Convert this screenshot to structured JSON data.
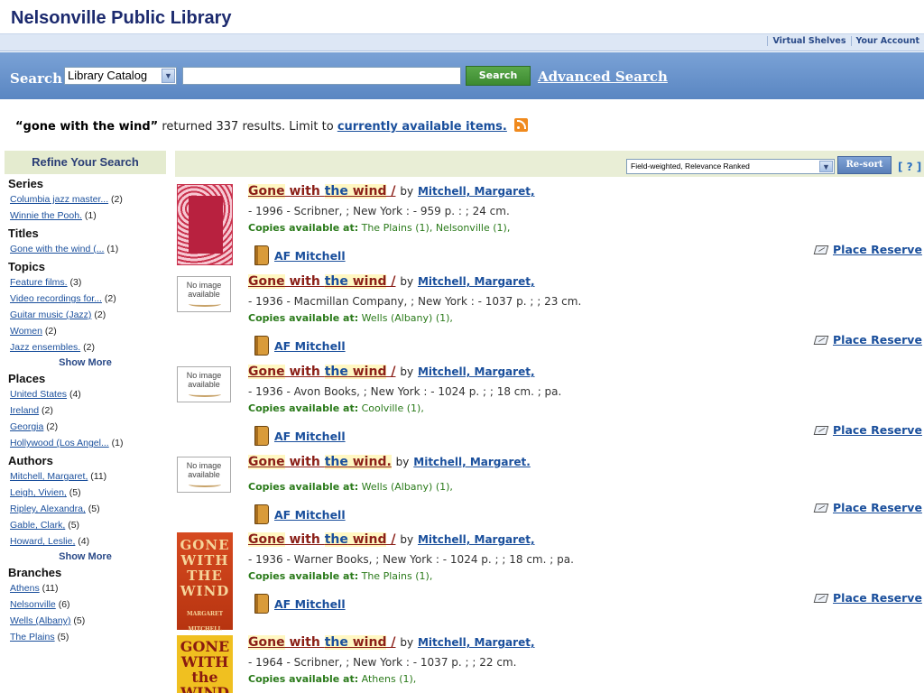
{
  "header": {
    "title": "Nelsonville Public Library"
  },
  "topnav": {
    "links": [
      "Virtual Shelves",
      "Your Account"
    ]
  },
  "search": {
    "label": "Search",
    "scope": "Library Catalog",
    "query_value": "",
    "button": "Search",
    "advanced": "Advanced Search"
  },
  "summary": {
    "query": "“gone with the wind”",
    "text": " returned 337 results. Limit to ",
    "limit_link": "currently available items."
  },
  "sort": {
    "selected": "Field-weighted, Relevance Ranked",
    "button": "Re-sort",
    "help": "[ ? ]"
  },
  "sidebar": {
    "title": "Refine Your Search",
    "facets": [
      {
        "title": "Series",
        "items": [
          {
            "label": "Columbia jazz master...",
            "count": "(2)"
          },
          {
            "label": "Winnie the Pooh.",
            "count": "(1)"
          }
        ]
      },
      {
        "title": "Titles",
        "items": [
          {
            "label": "Gone with the wind (...",
            "count": "(1)"
          }
        ]
      },
      {
        "title": "Topics",
        "items": [
          {
            "label": "Feature films.",
            "count": "(3)"
          },
          {
            "label": "Video recordings for...",
            "count": "(2)"
          },
          {
            "label": "Guitar music (Jazz)",
            "count": "(2)"
          },
          {
            "label": "Women",
            "count": "(2)"
          },
          {
            "label": "Jazz ensembles.",
            "count": "(2)"
          }
        ],
        "more": "Show More"
      },
      {
        "title": "Places",
        "items": [
          {
            "label": "United States",
            "count": "(4)"
          },
          {
            "label": "Ireland",
            "count": "(2)"
          },
          {
            "label": "Georgia",
            "count": "(2)"
          },
          {
            "label": "Hollywood (Los Angel...",
            "count": "(1)"
          }
        ]
      },
      {
        "title": "Authors",
        "items": [
          {
            "label": "Mitchell, Margaret,",
            "count": "(11)"
          },
          {
            "label": "Leigh, Vivien,",
            "count": "(5)"
          },
          {
            "label": "Ripley, Alexandra,",
            "count": "(5)"
          },
          {
            "label": "Gable, Clark,",
            "count": "(5)"
          },
          {
            "label": "Howard, Leslie,",
            "count": "(4)"
          }
        ],
        "more": "Show More"
      },
      {
        "title": "Branches",
        "items": [
          {
            "label": "Athens",
            "count": "(11)"
          },
          {
            "label": "Nelsonville",
            "count": "(6)"
          },
          {
            "label": "Wells (Albany)",
            "count": "(5)"
          },
          {
            "label": "The Plains",
            "count": "(5)"
          }
        ]
      }
    ]
  },
  "results": [
    {
      "cover": "red",
      "t1": "Gone",
      "t2": " with ",
      "t3": "the",
      "t4": " wind",
      "t5": " /",
      "by": "by",
      "author": "Mitchell, Margaret,",
      "pub": "- 1996 - Scribner, ; New York : - 959 p. : ; 24 cm.",
      "copies_label": "Copies available at:",
      "copies": "The Plains (1), Nelsonville (1),",
      "call": "AF Mitchell",
      "reserve": "Place Reserve"
    },
    {
      "cover": "none",
      "noimage": "No image available",
      "t1": "Gone",
      "t2": " with ",
      "t3": "the",
      "t4": " wind",
      "t5": " /",
      "by": "by",
      "author": "Mitchell, Margaret,",
      "pub": "- 1936 - Macmillan Company, ; New York : - 1037 p. ; ; 23 cm.",
      "copies_label": "Copies available at:",
      "copies": "Wells (Albany) (1),",
      "call": "AF Mitchell",
      "reserve": "Place Reserve"
    },
    {
      "cover": "none",
      "noimage": "No image available",
      "t1": "Gone",
      "t2": " with ",
      "t3": "the",
      "t4": " wind",
      "t5": " /",
      "by": "by",
      "author": "Mitchell, Margaret,",
      "pub": "- 1936 - Avon Books, ; New York : - 1024 p. ; ; 18 cm. ; pa.",
      "copies_label": "Copies available at:",
      "copies": "Coolville (1),",
      "call": "AF Mitchell",
      "reserve": "Place Reserve"
    },
    {
      "cover": "none",
      "noimage": "No image available",
      "t1": "Gone",
      "t2": " with ",
      "t3": "the",
      "t4": " wind.",
      "t5": "",
      "by": "by",
      "author": "Mitchell, Margaret.",
      "pub": "",
      "copies_label": "Copies available at:",
      "copies": "Wells (Albany) (1),",
      "call": "AF Mitchell",
      "reserve": "Place Reserve"
    },
    {
      "cover": "orange",
      "cover_text": "GONE WITH THE WIND",
      "cover_sub": "MARGARET MITCHELL",
      "t1": "Gone",
      "t2": " with ",
      "t3": "the",
      "t4": " wind",
      "t5": " /",
      "by": "by",
      "author": "Mitchell, Margaret,",
      "pub": "- 1936 - Warner Books, ; New York : - 1024 p. ; ; 18 cm. ; pa.",
      "copies_label": "Copies available at:",
      "copies": "The Plains (1),",
      "call": "AF Mitchell",
      "reserve": "Place Reserve"
    },
    {
      "cover": "yellow",
      "cover_text": "GONE WITH the WIND",
      "t1": "Gone",
      "t2": " with ",
      "t3": "the",
      "t4": " wind",
      "t5": " /",
      "by": "by",
      "author": "Mitchell, Margaret,",
      "pub": "- 1964 - Scribner, ; New York : - 1037 p. ; ; 22 cm.",
      "copies_label": "Copies available at:",
      "copies": "Athens (1),",
      "call": "",
      "reserve": ""
    }
  ]
}
